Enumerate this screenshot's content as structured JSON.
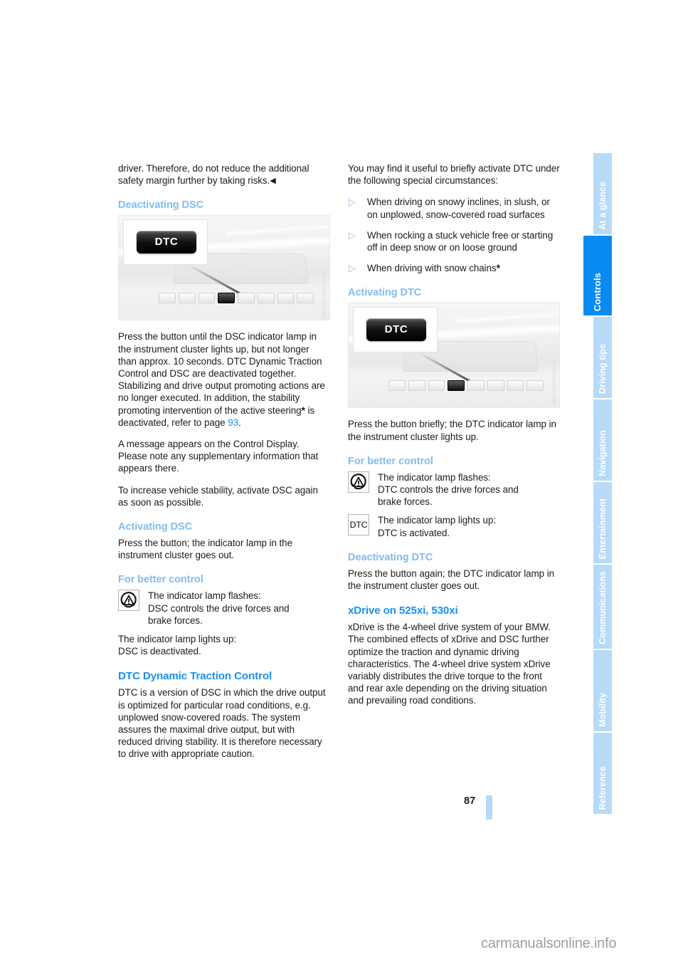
{
  "document": {
    "page_number": "87",
    "watermark": "carmanualsonline.info"
  },
  "sidebar": {
    "tabs": [
      {
        "label": "At a glance",
        "active": false
      },
      {
        "label": "Controls",
        "active": true
      },
      {
        "label": "Driving tips",
        "active": false
      },
      {
        "label": "Navigation",
        "active": false
      },
      {
        "label": "Entertainment",
        "active": false
      },
      {
        "label": "Communications",
        "active": false
      },
      {
        "label": "Mobility",
        "active": false
      },
      {
        "label": "Reference",
        "active": false
      }
    ]
  },
  "colors": {
    "heading_major": "#1a8ff0",
    "heading_minor": "#82bdf0",
    "tab_active": "#0a8bf2",
    "tab_inactive": "#b7daf8",
    "page_bar": "#b7daf8",
    "link": "#1a8ff0"
  },
  "left_column": {
    "intro_paragraph": "driver. Therefore, do not reduce the additional safety margin further by taking risks.",
    "intro_endmark": "◀",
    "heading_deactivating_dsc": "Deactivating DSC",
    "figure_dsc": {
      "button_label": "DTC",
      "code": "WKDSC2FA0VAUS"
    },
    "para_press_button": "Press the button until the DSC indicator lamp in the instrument cluster lights up, but not longer than approx. 10 seconds. DTC Dynamic Traction Control and DSC are deactivated together. Stabilizing and drive output promoting actions are no longer executed. In addition, the stability promoting intervention of the active steering",
    "para_press_button_after_asterisk": " is deactivated, refer to page ",
    "para_press_button_pageref": "93",
    "para_press_button_end": ".",
    "para_message": "A message appears on the Control Display. Please note any supplementary information that appears there.",
    "para_increase": "To increase vehicle stability, activate DSC again as soon as possible.",
    "heading_activating_dsc": "Activating DSC",
    "para_activating_dsc": "Press the button; the indicator lamp in the instrument cluster goes out.",
    "heading_for_better_control": "For better control",
    "lamp_flash": {
      "icon": "dsc-warning-icon",
      "line1": "The indicator lamp flashes:",
      "line2": "DSC controls the drive forces and",
      "line3": "brake forces."
    },
    "lamp_steady": {
      "line1": "The indicator lamp lights up:",
      "line2": "DSC is deactivated."
    },
    "heading_dtc": "DTC Dynamic Traction Control",
    "para_dtc": "DTC is a version of DSC in which the drive output is optimized for particular road conditions, e.g. unplowed snow-covered roads. The system assures the maximal drive output, but with reduced driving stability. It is therefore necessary to drive with appropriate caution."
  },
  "right_column": {
    "para_useful": "You may find it useful to briefly activate DTC under the following special circumstances:",
    "bullets": [
      {
        "marker": "▷",
        "text": "When driving on snowy inclines, in slush, or on unplowed, snow-covered road surfaces",
        "asterisk": false
      },
      {
        "marker": "▷",
        "text": "When rocking a stuck vehicle free or starting off in deep snow or on loose ground",
        "asterisk": false
      },
      {
        "marker": "▷",
        "text": "When driving with snow chains",
        "asterisk": true
      }
    ],
    "heading_activating_dtc": "Activating DTC",
    "figure_dtc": {
      "button_label": "DTC",
      "code": "WKDSC2FA0VAUS"
    },
    "para_press_briefly": "Press the button briefly; the DTC indicator lamp in the instrument cluster lights up.",
    "heading_for_better_control": "For better control",
    "lamp_flash": {
      "icon": "dsc-warning-icon",
      "line1": "The indicator lamp flashes:",
      "line2": "DTC controls the drive forces and",
      "line3": "brake forces."
    },
    "lamp_steady": {
      "icon": "dtc-lamp-icon",
      "icon_text": "DTC",
      "line1": "The indicator lamp lights up:",
      "line2": "DTC is activated."
    },
    "heading_deactivating_dtc": "Deactivating DTC",
    "para_deactivating_dtc": "Press the button again; the DTC indicator lamp in the instrument cluster goes out.",
    "heading_xdrive": "xDrive on 525xi, 530xi",
    "para_xdrive": "xDrive is the 4-wheel drive system of your BMW. The combined effects of xDrive and DSC further optimize the traction and dynamic driving characteristics. The 4-wheel drive system xDrive variably distributes the drive torque to the front and rear axle depending on the driving situation and prevailing road conditions."
  }
}
